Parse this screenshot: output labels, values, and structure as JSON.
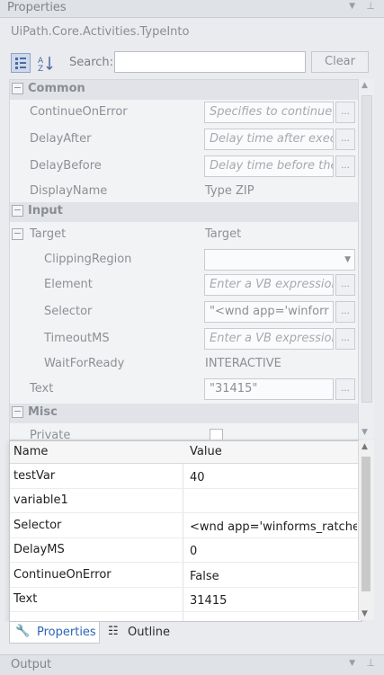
{
  "panel": {
    "title": "Properties",
    "activity_type": "UiPath.Core.Activities.TypeInto",
    "search_label": "Search:",
    "search_value": "",
    "clear_label": "Clear"
  },
  "grid": {
    "categories": {
      "common": "Common",
      "input": "Input",
      "misc": "Misc"
    },
    "rows": {
      "continue_on_error": {
        "name": "ContinueOnError",
        "value": "Specifies to continue"
      },
      "delay_after": {
        "name": "DelayAfter",
        "value": "Delay time after exec"
      },
      "delay_before": {
        "name": "DelayBefore",
        "value": "Delay time before the"
      },
      "display_name": {
        "name": "DisplayName",
        "value": "Type ZIP"
      },
      "target": {
        "name": "Target",
        "value": "Target"
      },
      "clipping_region": {
        "name": "ClippingRegion",
        "value": ""
      },
      "element": {
        "name": "Element",
        "value": "Enter a VB expressior"
      },
      "selector": {
        "name": "Selector",
        "value": "\"<wnd app='winforr"
      },
      "timeout_ms": {
        "name": "TimeoutMS",
        "value": "Enter a VB expressior"
      },
      "wait_for_ready": {
        "name": "WaitForReady",
        "value": "INTERACTIVE"
      },
      "text": {
        "name": "Text",
        "value": "\"31415\""
      },
      "private": {
        "name": "Private",
        "checked": false
      }
    },
    "ellipsis": "..."
  },
  "variables": {
    "headers": {
      "name": "Name",
      "value": "Value"
    },
    "rows": [
      {
        "name": "testVar",
        "value": "40"
      },
      {
        "name": "variable1",
        "value": ""
      },
      {
        "name": "Selector",
        "value": "<wnd app='winforms_ratche"
      },
      {
        "name": "DelayMS",
        "value": "0"
      },
      {
        "name": "ContinueOnError",
        "value": "False"
      },
      {
        "name": "Text",
        "value": "31415"
      }
    ]
  },
  "tabs": {
    "properties": "Properties",
    "outline": "Outline"
  },
  "output": {
    "title": "Output"
  },
  "colors": {
    "accent": "#2b65b5",
    "grid_bg": "#f2f3f5",
    "category_bg": "#e1e3e8"
  },
  "icons": [
    "pin-icon",
    "dropdown-icon",
    "categorized-icon",
    "alphabetical-icon",
    "wrench-icon",
    "outline-icon"
  ]
}
